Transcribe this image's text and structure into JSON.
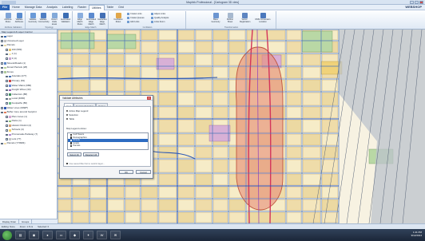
{
  "window": {
    "title": "MapInfo Professional - [Cartogram 3D view]"
  },
  "menu": {
    "file": "File",
    "tabs": [
      "Home",
      "Manage Data",
      "Analysis",
      "Labeling",
      "Raster",
      "Utilities",
      "Table",
      "Grid"
    ],
    "active": "Utilities"
  },
  "ribbon": {
    "groups": [
      {
        "label": "Attribute Validation",
        "buttons": [
          "Attribute Rules",
          "Validate Attributes"
        ]
      },
      {
        "label": "Topology",
        "buttons": [
          "Validate Geometry",
          "Validate Connectivity",
          "Detect Voids areas",
          "Automated Validation"
        ]
      },
      {
        "label": "Edge Match",
        "buttons": [
          "Edge Match Rules",
          "Automated Edge Match",
          "Interactive Edge Match"
        ]
      },
      {
        "label": "Conflation",
        "buttons": [
          "Conflation Rules",
          "Create Queues",
          "Add Links",
          "Links Zoom"
        ]
      },
      {
        "label": "Transformation",
        "buttons": [
          "Base Geometry",
          "Rubber Sheet",
          "Vector Registration",
          "DMS Conversion Location"
        ]
      }
    ],
    "small": [
      "Create Links",
      "Create Queues",
      "Add Links",
      "Adjust Links",
      "Quality Analysis",
      "Links Zoom"
    ]
  },
  "brand": "WEBSHOP",
  "panel": {
    "title": "Map Legend & Layer Control",
    "layers": [
      {
        "label": "Layer",
        "color": "#3b6db3"
      },
      {
        "label": "Unnamed Layer",
        "color": "#c0c0c0"
      },
      {
        "label": "Parcels",
        "color": "#e8d9a8"
      },
      {
        "label": "100 (583)",
        "color": "#e7c46a"
      },
      {
        "label": "1 (1)",
        "color": "#f3e7b8"
      },
      {
        "label": "3 (4)",
        "color": "#caa8d6"
      },
      {
        "label": "Streets/Roads (1)",
        "color": "#5b86c8"
      },
      {
        "label": "Zoned Parcels (28)",
        "color": "#b8d49a"
      },
      {
        "label": "Zones",
        "color": "#aec99a"
      },
      {
        "label": "Arterials (477)",
        "color": "#4b74b8"
      },
      {
        "label": "Primary (63)",
        "color": "#d04b4b"
      },
      {
        "label": "Water Mains (986)",
        "color": "#6a8ad6"
      },
      {
        "label": "Freight Wires (33)",
        "color": "#9f5fb3"
      },
      {
        "label": "Collectors (88)",
        "color": "#3d8f5e"
      },
      {
        "label": "Local (4090)",
        "color": "#a0a0a0"
      },
      {
        "label": "Footpaths (86)",
        "color": "#6fbf8a"
      },
      {
        "label": "Water Lines (6098*)",
        "color": "#2d58b4"
      },
      {
        "label": "Buffer zone around footprint",
        "color": "#e07b5a"
      },
      {
        "label": "Plan zones (1)",
        "color": "#d9a8d6"
      },
      {
        "label": "Parks (1)",
        "color": "#8fc078"
      },
      {
        "label": "Historic District (4)",
        "color": "#d8a37a"
      },
      {
        "label": "Schools (4)",
        "color": "#f4d370"
      },
      {
        "label": "Promenade-Parkway (7)",
        "color": "#b48ad4"
      },
      {
        "label": "Lots (77)",
        "color": "#c7c7c7"
      },
      {
        "label": "Parcels (770984)",
        "color": "#f1dfb0"
      }
    ],
    "tabs": [
      "Display Order",
      "Groups"
    ]
  },
  "dialog": {
    "title": "Validate Attributes",
    "tabs": [
      "Input",
      "Feature Selection",
      "Output"
    ],
    "radio1": "Active Map Legend",
    "radio2": "Selection",
    "radio3": "Table",
    "list_label": "Map Legend entries:",
    "items": [
      "Cell Towers",
      "Demographics",
      "Streets",
      "Hotels",
      "Parcels"
    ],
    "selected": "Parcels",
    "select_all": "Select All",
    "deselect_all": "Deselect All",
    "footer_check": "Use saved filter list to restrict layer...",
    "ok": "OK",
    "cancel": "Cancel"
  },
  "status": {
    "left": "Editing: None",
    "middle": "Zoom: 1.8 mi",
    "right": "Selected: 0"
  },
  "taskbar": {
    "time": "1:41 PM",
    "date": "9/12/2014"
  }
}
